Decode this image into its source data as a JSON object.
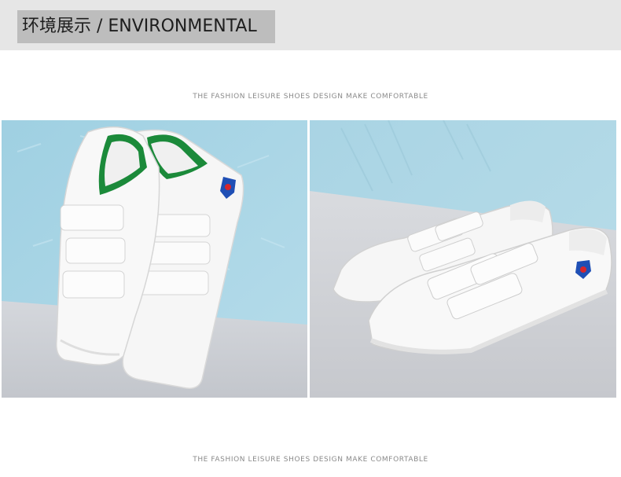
{
  "header": {
    "title": "环境展示 / ENVIRONMENTAL"
  },
  "tagline_top": "THE FASHION LEISURE SHOES DESIGN MAKE COMFORTABLE",
  "tagline_bottom": "THE FASHION LEISURE SHOES DESIGN MAKE COMFORTABLE",
  "photos": [
    {
      "subject": "pair-of-white-strap-sneakers-leaning-on-wall"
    },
    {
      "subject": "pair-of-white-strap-sneakers-side-view"
    }
  ],
  "colors": {
    "header_band": "#e6e6e6",
    "header_label": "#bdbdbd",
    "wall_blue": "#a7d3e3",
    "floor_grey": "#cfd2d7",
    "shoe_white": "#f7f7f7",
    "lining_green": "#1b8a3a",
    "badge_blue": "#1f4fb5",
    "badge_red": "#d8262c"
  }
}
